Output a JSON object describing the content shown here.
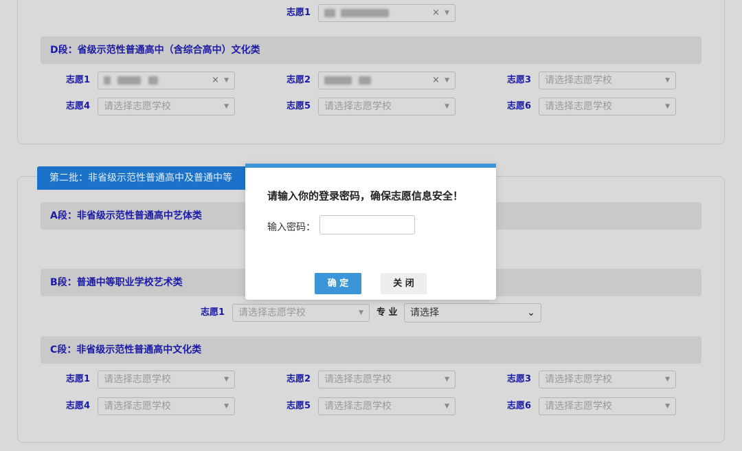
{
  "placeholder": "请选择志愿学校",
  "top": {
    "choice1_label": "志愿1"
  },
  "sectionD": {
    "title": "D段：省级示范性普通高中（含综合高中）文化类",
    "labels": [
      "志愿1",
      "志愿2",
      "志愿3",
      "志愿4",
      "志愿5",
      "志愿6"
    ]
  },
  "batch2_tab": "第二批：非省级示范性普通高中及普通中等",
  "sectionA": {
    "title": "A段：非省级示范性普通高中艺体类"
  },
  "sectionB": {
    "title": "B段：普通中等职业学校艺术类",
    "choice1_label": "志愿1",
    "major_label": "专 业",
    "major_value": "请选择"
  },
  "sectionC": {
    "title": "C段：非省级示范性普通高中文化类",
    "labels": [
      "志愿1",
      "志愿2",
      "志愿3",
      "志愿4",
      "志愿5",
      "志愿6"
    ]
  },
  "icons": {
    "clear": "×",
    "dropdown": "▼",
    "chevron": "⌄"
  },
  "modal": {
    "title": "请输入你的登录密码，确保志愿信息安全！",
    "password_label": "输入密码：",
    "password_value": "",
    "ok_label": "确 定",
    "close_label": "关 闭"
  },
  "colors": {
    "accent": "#3b95d9",
    "tab": "#1a73c9",
    "label": "#1a1aa6"
  }
}
